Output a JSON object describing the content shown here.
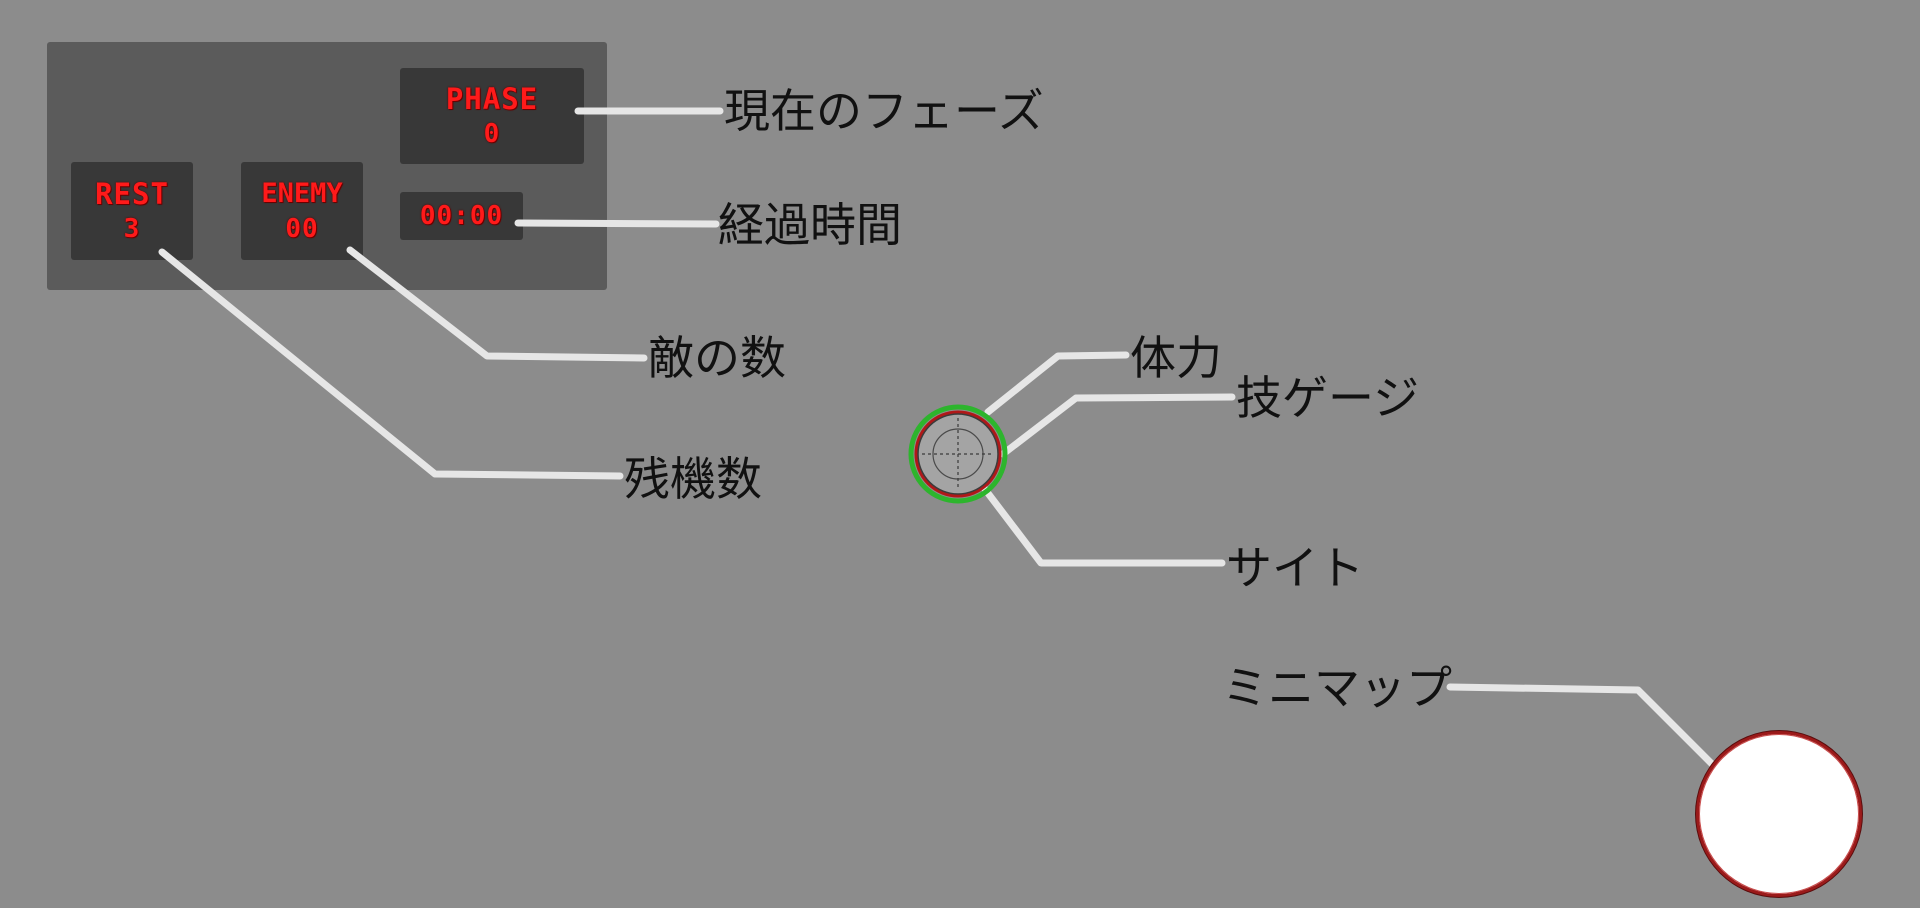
{
  "hud": {
    "phase": {
      "label": "PHASE",
      "value": "0"
    },
    "rest": {
      "label": "REST",
      "value": "3"
    },
    "enemy": {
      "label": "ENEMY",
      "value": "00"
    },
    "timer": {
      "value": "00:00"
    }
  },
  "callouts": {
    "phase": "現在のフェーズ",
    "elapsed_time": "経過時間",
    "enemy_count": "敵の数",
    "remaining_lives": "残機数",
    "health": "体力",
    "skill_gauge": "技ゲージ",
    "sight": "サイト",
    "minimap": "ミニマップ"
  },
  "colors": {
    "background": "#8c8c8c",
    "panel": "#5b5b5b",
    "stat_box": "#383838",
    "digital_text": "#ff1a1a",
    "leader_line": "#e6e6e6",
    "health_ring": "#2db52d",
    "skill_ring": "#b01818",
    "minimap_border": "#9b1a1a"
  }
}
